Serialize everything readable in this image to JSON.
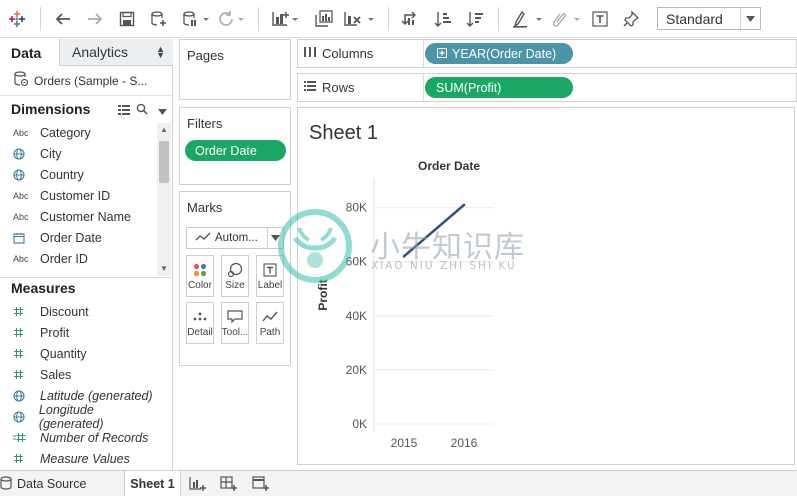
{
  "toolbar": {
    "items": [
      "tableau-logo-icon",
      "undo-icon",
      "redo-icon",
      "save-icon",
      "new-datasource-icon",
      "pause-updates-icon",
      "refresh-icon",
      "new-worksheet-icon",
      "duplicate-sheet-icon",
      "clear-sheet-icon",
      "swap-axes-icon",
      "sort-ascending-icon",
      "sort-descending-icon",
      "highlight-icon",
      "group-icon",
      "show-labels-icon",
      "pin-icon"
    ],
    "view_mode": "Standard"
  },
  "data_pane": {
    "tab_data": "Data",
    "tab_analytics": "Analytics",
    "datasource": "Orders (Sample - S...",
    "dimensions_title": "Dimensions",
    "dimensions": [
      {
        "icon": "Abc",
        "name": "Category"
      },
      {
        "icon": "globe",
        "name": "City"
      },
      {
        "icon": "globe",
        "name": "Country"
      },
      {
        "icon": "Abc",
        "name": "Customer ID"
      },
      {
        "icon": "Abc",
        "name": "Customer Name"
      },
      {
        "icon": "calendar",
        "name": "Order Date"
      },
      {
        "icon": "Abc",
        "name": "Order ID"
      }
    ],
    "measures_title": "Measures",
    "measures": [
      {
        "icon": "#",
        "name": "Discount"
      },
      {
        "icon": "#",
        "name": "Profit"
      },
      {
        "icon": "#",
        "name": "Quantity"
      },
      {
        "icon": "#",
        "name": "Sales"
      },
      {
        "icon": "globe",
        "name": "Latitude (generated)"
      },
      {
        "icon": "globe",
        "name": "Longitude (generated)"
      },
      {
        "icon": "=#",
        "name": "Number of Records"
      },
      {
        "icon": "#",
        "name": "Measure Values"
      }
    ]
  },
  "pages": {
    "title": "Pages"
  },
  "filters": {
    "title": "Filters",
    "pill": "Order Date"
  },
  "marks": {
    "title": "Marks",
    "type": "Autom...",
    "buttons": [
      "Color",
      "Size",
      "Label",
      "Detail",
      "Tool...",
      "Path"
    ]
  },
  "shelves": {
    "columns_label": "Columns",
    "columns_pill": "YEAR(Order Date)",
    "rows_label": "Rows",
    "rows_pill": "SUM(Profit)"
  },
  "sheet": {
    "title": "Sheet 1",
    "watermark_cn": "小牛知识库",
    "watermark_en": "XIAO NIU ZHI SHI KU"
  },
  "chart_data": {
    "type": "line",
    "title": "Order Date",
    "xlabel": "",
    "ylabel": "Profit",
    "categories": [
      "2015",
      "2016"
    ],
    "series": [
      {
        "values": [
          62000,
          81000
        ]
      }
    ],
    "ylim": [
      0,
      88000
    ],
    "yticks": [
      0,
      20000,
      40000,
      60000,
      80000
    ],
    "ytick_labels": [
      "0K",
      "20K",
      "40K",
      "60K",
      "80K"
    ],
    "grid": true,
    "line_color": "#2f4f7f"
  },
  "bottom_tabs": {
    "data_source": "Data Source",
    "sheet": "Sheet 1"
  }
}
